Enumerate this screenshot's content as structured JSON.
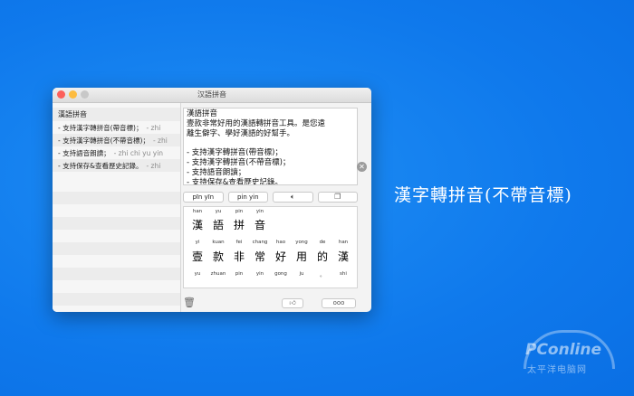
{
  "window": {
    "title": "汉語拼音",
    "lights": [
      {
        "name": "close",
        "color": "#fc605b"
      },
      {
        "name": "minimize",
        "color": "#fdbc40"
      },
      {
        "name": "zoom",
        "color": "#c8c8c8"
      }
    ]
  },
  "sidebar": {
    "items": [
      {
        "label": "漢語拼音",
        "note": ""
      },
      {
        "label": "- 支持漢字轉拼音(帶音標)；",
        "note": "- zhi"
      },
      {
        "label": "- 支持漢字轉拼音(不帶音標)；",
        "note": "- zhi"
      },
      {
        "label": "- 支持語音朗讀；",
        "note": "- zhi chi yu yin"
      },
      {
        "label": "- 支持保存&查看歷史記錄。",
        "note": "- zhi"
      }
    ]
  },
  "editor": {
    "text": "漢語拼音\n壹款非常好用的漢語轉拼音工具。是您遠\n離生僻字、學好漢語的好幫手。\n\n- 支持漢字轉拼音(帶音標)；\n- 支持漢字轉拼音(不帶音標)；\n- 支持語音朗讀；\n- 支持保存&查看歷史記錄。"
  },
  "toolbar": {
    "pinyin_toned": "pīn yīn",
    "pinyin_plain": "pin yin",
    "speak_icon": "speaker-icon",
    "copy_icon": "copy-icon"
  },
  "result": {
    "rows": [
      {
        "pinyin": [
          "han",
          "yu",
          "pin",
          "yin"
        ],
        "hanzi": [
          "漢",
          "語",
          "拼",
          "音"
        ]
      },
      {
        "pinyin": [
          "yi",
          "kuan",
          "fei",
          "chang",
          "hao",
          "yong",
          "de",
          "han"
        ],
        "hanzi": [
          "壹",
          "款",
          "非",
          "常",
          "好",
          "用",
          "的",
          "漢"
        ]
      },
      {
        "pinyin": [
          "yu",
          "zhuan",
          "pin",
          "yin",
          "gong",
          "ju",
          "。",
          "shi"
        ],
        "hanzi": []
      }
    ]
  },
  "bottom": {
    "trash_icon": "trash-icon",
    "like_icon": "thumbs-up-icon",
    "more_label": "ooo"
  },
  "slogan": "漢字轉拼音(不帶音標)",
  "watermark": {
    "brand": "PConline",
    "sub": "太平洋电脑网"
  }
}
